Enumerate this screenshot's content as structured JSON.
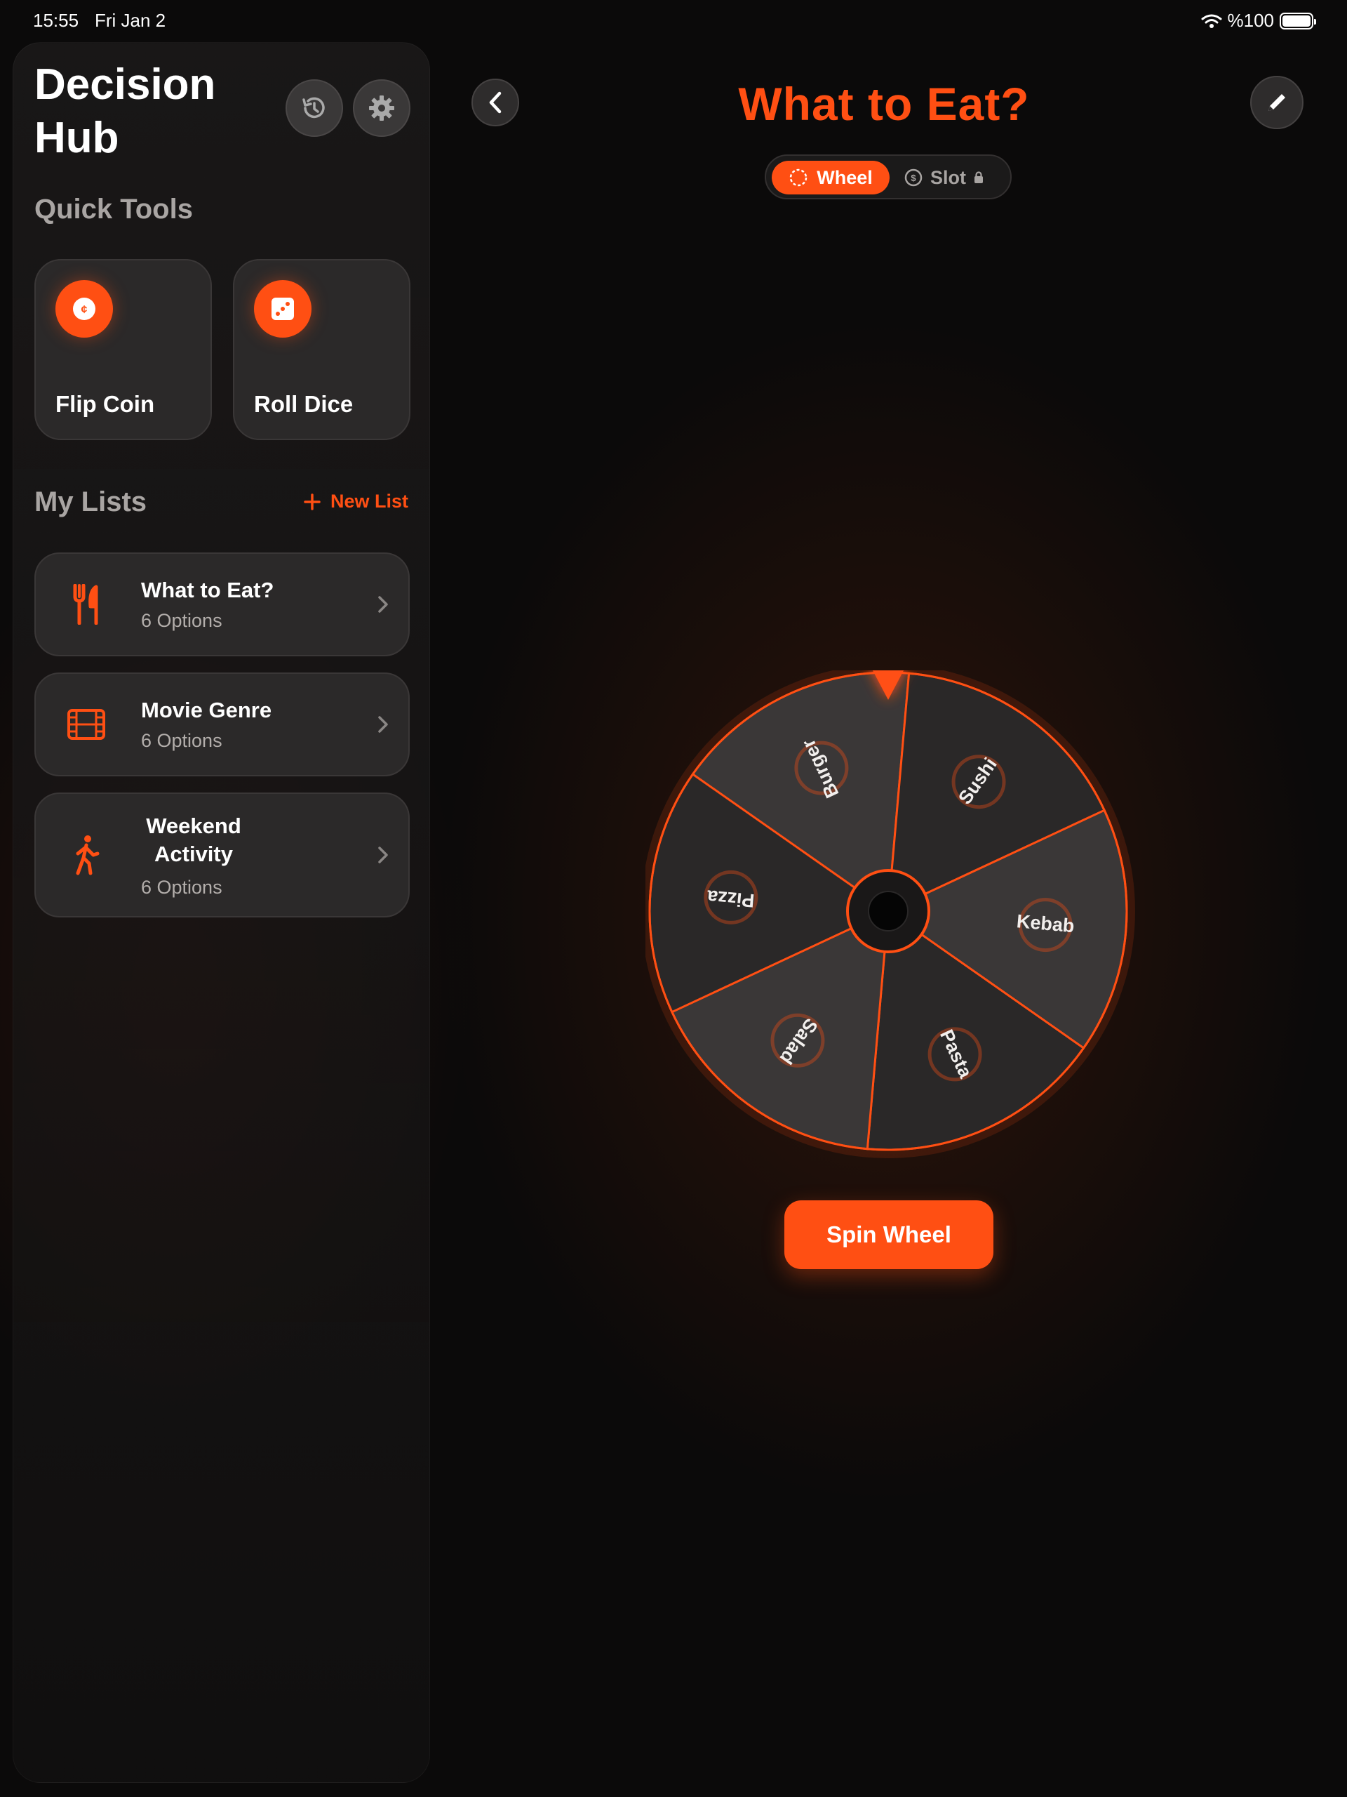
{
  "status": {
    "time": "15:55",
    "date": "Fri Jan 2",
    "battery": "%100"
  },
  "sidebar": {
    "app_title": "Decision Hub",
    "quick_tools_title": "Quick Tools",
    "tools": [
      {
        "label": "Flip Coin",
        "icon": "coin-icon"
      },
      {
        "label": "Roll Dice",
        "icon": "dice-icon"
      }
    ],
    "my_lists_title": "My Lists",
    "new_list_label": "New List",
    "lists": [
      {
        "title": "What to Eat?",
        "subtitle": "6 Options",
        "icon": "fork-knife-icon"
      },
      {
        "title": "Movie Genre",
        "subtitle": "6 Options",
        "icon": "film-icon"
      },
      {
        "title_line1": "Weekend",
        "title_line2": "Activity",
        "subtitle": "6 Options",
        "icon": "walking-icon"
      }
    ]
  },
  "main": {
    "title": "What to Eat?",
    "mode_wheel": "Wheel",
    "mode_slot": "Slot",
    "wheel_options": [
      "Burger",
      "Sushi",
      "Kebab",
      "Pasta",
      "Salad",
      "Pizza"
    ],
    "spin_label": "Spin Wheel"
  },
  "colors": {
    "accent": "#ff4f13",
    "background": "#0b0a0a",
    "card": "#2b2929"
  }
}
